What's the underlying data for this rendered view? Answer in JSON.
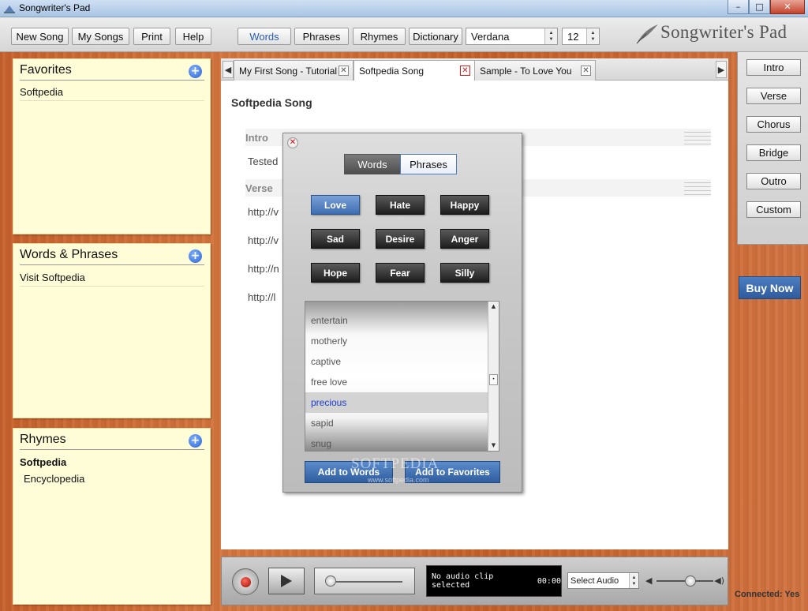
{
  "window": {
    "title": "Songwriter's Pad",
    "controls": {
      "minimize": "–",
      "maximize": "□",
      "close": "✕"
    }
  },
  "toolbar": {
    "buttons": [
      "New Song",
      "My Songs",
      "Print",
      "Help"
    ],
    "modes": [
      "Words",
      "Phrases",
      "Rhymes",
      "Dictionary"
    ],
    "active_mode": "Words",
    "font": "Verdana",
    "font_size": "12",
    "logo_text": "Songwriter's Pad"
  },
  "panels": {
    "favorites": {
      "title": "Favorites",
      "items": [
        "Softpedia"
      ]
    },
    "words_phrases": {
      "title": "Words & Phrases",
      "items": [
        "Visit Softpedia"
      ]
    },
    "rhymes": {
      "title": "Rhymes",
      "items": [
        "Softpedia",
        "Encyclopedia"
      ]
    }
  },
  "tabs": {
    "items": [
      "My First Song - Tutorial",
      "Softpedia Song",
      "Sample - To Love You"
    ],
    "active": "Softpedia Song",
    "close_glyph": "✕",
    "scroll_left": "◀",
    "scroll_right": "▶"
  },
  "song": {
    "title": "Softpedia Song",
    "sections": [
      {
        "name": "Intro",
        "lines": [
          "Tested"
        ]
      },
      {
        "name": "Verse",
        "lines": [
          "http://v",
          "http://v",
          "http://n",
          "http://l"
        ]
      }
    ]
  },
  "section_buttons": [
    "Intro",
    "Verse",
    "Chorus",
    "Bridge",
    "Outro",
    "Custom"
  ],
  "buy_now": "Buy Now",
  "popup": {
    "close_glyph": "✕",
    "toggle": [
      "Words",
      "Phrases"
    ],
    "moods": [
      "Love",
      "Hate",
      "Happy",
      "Sad",
      "Desire",
      "Anger",
      "Hope",
      "Fear",
      "Silly"
    ],
    "selected_mood": "Love",
    "words": [
      "entertain",
      "motherly",
      "captive",
      "free love",
      "precious",
      "sapid",
      "snug"
    ],
    "selected_word": "precious",
    "buttons": [
      "Add to Words",
      "Add to Favorites"
    ]
  },
  "audio": {
    "lcd_text": "No audio clip selected",
    "time": "00:00",
    "select_label": "Select Audio",
    "seek_position": 0.05,
    "volume_level": 0.6
  },
  "status": "Connected: Yes",
  "watermark": {
    "main": "SOFTPEDIA",
    "sub": "www.softpedia.com"
  }
}
